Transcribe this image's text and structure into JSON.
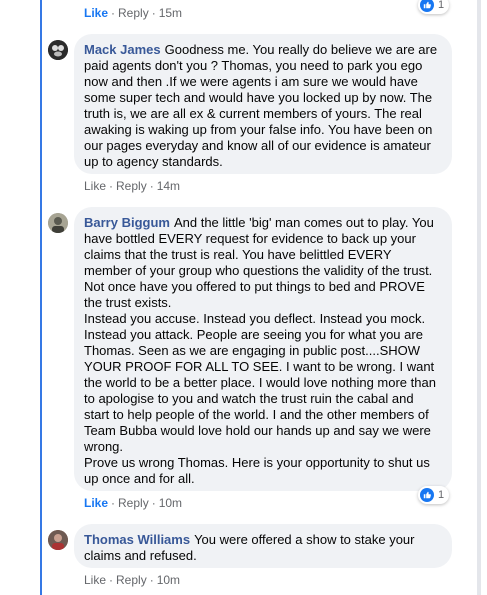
{
  "comments": [
    {
      "author": "",
      "text": "",
      "actions": {
        "like": "Like",
        "reply": "Reply",
        "time": "15m"
      },
      "reactions": {
        "count": "1"
      }
    },
    {
      "author": "Mack James",
      "text": "Goodness me. You really do believe we are are paid agents don't you ? Thomas, you need to park you ego now and then .If we were agents i am sure we would have some super tech and would have you locked up by now. The truth is, we are all ex & current members of yours. The real awaking is waking up from your false info. You have been on our pages everyday and know all of our evidence is amateur up to agency standards.",
      "actions": {
        "like": "Like",
        "reply": "Reply",
        "time": "14m"
      }
    },
    {
      "author": "Barry Biggum",
      "text": "And the little 'big' man comes out to play. You have bottled EVERY request for evidence to back up your claims that the trust is real. You have belittled EVERY member of your group who questions the validity of the trust. Not once have you offered to put things to bed and PROVE the trust exists.\nInstead you accuse. Instead you deflect. Instead you mock. Instead you attack. People are seeing you for what you are Thomas. Seen as we are engaging in public post....SHOW YOUR PROOF FOR ALL TO SEE. I want to be wrong. I want the world to be a better place. I would love nothing more than to apologise to you and watch the trust ruin the cabal and start to help people of the world. I and the other members of Team Bubba would love hold our hands up and say we were wrong.\nProve us wrong Thomas. Here is your opportunity to shut us up once and for all.",
      "actions": {
        "like": "Like",
        "reply": "Reply",
        "time": "10m"
      },
      "reactions": {
        "count": "1"
      }
    },
    {
      "author": "Thomas Williams",
      "text": "You were offered a show to stake your claims and refused.",
      "actions": {
        "like": "Like",
        "reply": "Reply",
        "time": "10m"
      }
    }
  ],
  "colors": {
    "thread_line": "#3578e5",
    "author": "#385898",
    "like_active": "#1877f2",
    "bubble": "#f0f2f5"
  }
}
